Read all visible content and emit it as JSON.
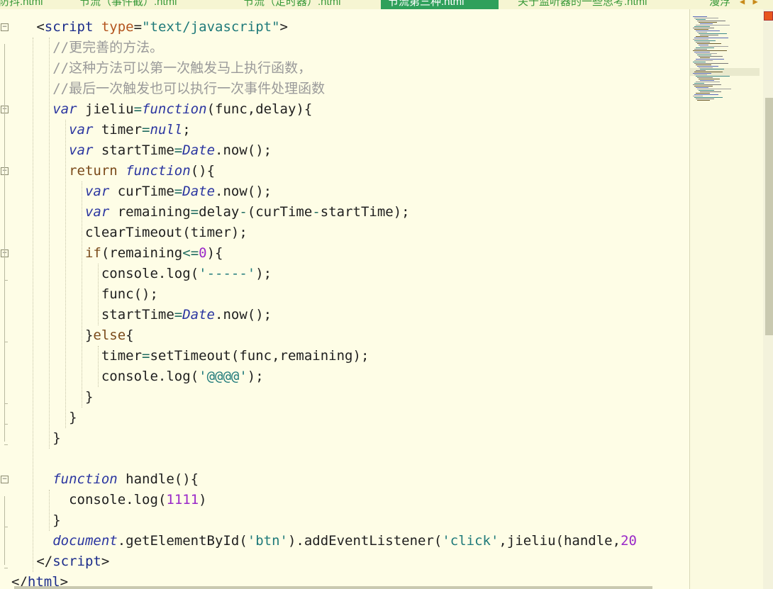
{
  "tabs": [
    {
      "label": "防抖.html",
      "active": false
    },
    {
      "label": "节流（事件截）.html",
      "active": false
    },
    {
      "label": "节流（定时器）.html",
      "active": false
    },
    {
      "label": "节流第三种.html",
      "active": true
    },
    {
      "label": "关于监听器的一些思考.html",
      "active": false
    },
    {
      "label": "漫浮",
      "active": false
    }
  ],
  "tab_arrows": "◀ ▶",
  "code_lines": [
    [
      [
        "t-punc",
        "<"
      ],
      [
        "t-tag",
        "script"
      ],
      [
        "t-punc",
        " "
      ],
      [
        "t-attr",
        "type"
      ],
      [
        "t-punc",
        "="
      ],
      [
        "t-str",
        "\"text/javascript\""
      ],
      [
        "t-punc",
        ">"
      ]
    ],
    [
      [
        "t-cmt",
        "//更完善的方法。"
      ]
    ],
    [
      [
        "t-cmt",
        "//这种方法可以第一次触发马上执行函数，"
      ]
    ],
    [
      [
        "t-cmt",
        "//最后一次触发也可以执行一次事件处理函数"
      ]
    ],
    [
      [
        "t-kw",
        "var"
      ],
      [
        "t-id",
        " jieliu"
      ],
      [
        "t-op",
        "="
      ],
      [
        "t-kw",
        "function"
      ],
      [
        "t-punc",
        "("
      ],
      [
        "t-id",
        "func"
      ],
      [
        "t-punc",
        ","
      ],
      [
        "t-id",
        "delay"
      ],
      [
        "t-punc",
        "){"
      ]
    ],
    [
      [
        "t-kw",
        "var"
      ],
      [
        "t-id",
        " timer"
      ],
      [
        "t-op",
        "="
      ],
      [
        "t-kw",
        "null"
      ],
      [
        "t-punc",
        ";"
      ]
    ],
    [
      [
        "t-kw",
        "var"
      ],
      [
        "t-id",
        " startTime"
      ],
      [
        "t-op",
        "="
      ],
      [
        "t-cls",
        "Date"
      ],
      [
        "t-punc",
        "."
      ],
      [
        "t-id",
        "now"
      ],
      [
        "t-punc",
        "();"
      ]
    ],
    [
      [
        "t-ret",
        "return"
      ],
      [
        "t-id",
        " "
      ],
      [
        "t-kw",
        "function"
      ],
      [
        "t-punc",
        "(){"
      ]
    ],
    [
      [
        "t-kw",
        "var"
      ],
      [
        "t-id",
        " curTime"
      ],
      [
        "t-op",
        "="
      ],
      [
        "t-cls",
        "Date"
      ],
      [
        "t-punc",
        "."
      ],
      [
        "t-id",
        "now"
      ],
      [
        "t-punc",
        "();"
      ]
    ],
    [
      [
        "t-kw",
        "var"
      ],
      [
        "t-id",
        " remaining"
      ],
      [
        "t-op",
        "="
      ],
      [
        "t-id",
        "delay"
      ],
      [
        "t-op",
        "-"
      ],
      [
        "t-punc",
        "("
      ],
      [
        "t-id",
        "curTime"
      ],
      [
        "t-op",
        "-"
      ],
      [
        "t-id",
        "startTime"
      ],
      [
        "t-punc",
        ");"
      ]
    ],
    [
      [
        "t-id",
        "clearTimeout"
      ],
      [
        "t-punc",
        "("
      ],
      [
        "t-id",
        "timer"
      ],
      [
        "t-punc",
        ");"
      ]
    ],
    [
      [
        "t-ret",
        "if"
      ],
      [
        "t-punc",
        "("
      ],
      [
        "t-id",
        "remaining"
      ],
      [
        "t-op",
        "<="
      ],
      [
        "t-num",
        "0"
      ],
      [
        "t-punc",
        "){"
      ]
    ],
    [
      [
        "t-id",
        "console"
      ],
      [
        "t-punc",
        "."
      ],
      [
        "t-id",
        "log"
      ],
      [
        "t-punc",
        "("
      ],
      [
        "t-str",
        "'-----'"
      ],
      [
        "t-punc",
        ");"
      ]
    ],
    [
      [
        "t-id",
        "func"
      ],
      [
        "t-punc",
        "();"
      ]
    ],
    [
      [
        "t-id",
        "startTime"
      ],
      [
        "t-op",
        "="
      ],
      [
        "t-cls",
        "Date"
      ],
      [
        "t-punc",
        "."
      ],
      [
        "t-id",
        "now"
      ],
      [
        "t-punc",
        "();"
      ]
    ],
    [
      [
        "t-punc",
        "}"
      ],
      [
        "t-ret",
        "else"
      ],
      [
        "t-punc",
        "{"
      ]
    ],
    [
      [
        "t-id",
        "timer"
      ],
      [
        "t-op",
        "="
      ],
      [
        "t-id",
        "setTimeout"
      ],
      [
        "t-punc",
        "("
      ],
      [
        "t-id",
        "func"
      ],
      [
        "t-punc",
        ","
      ],
      [
        "t-id",
        "remaining"
      ],
      [
        "t-punc",
        ");"
      ]
    ],
    [
      [
        "t-id",
        "console"
      ],
      [
        "t-punc",
        "."
      ],
      [
        "t-id",
        "log"
      ],
      [
        "t-punc",
        "("
      ],
      [
        "t-str",
        "'@@@@'"
      ],
      [
        "t-punc",
        ");"
      ]
    ],
    [
      [
        "t-punc",
        "}"
      ]
    ],
    [
      [
        "t-punc",
        "}"
      ]
    ],
    [
      [
        "t-punc",
        "}"
      ]
    ],
    [],
    [
      [
        "t-kw",
        "function"
      ],
      [
        "t-id",
        " handle"
      ],
      [
        "t-punc",
        "(){"
      ]
    ],
    [
      [
        "t-id",
        "console"
      ],
      [
        "t-punc",
        "."
      ],
      [
        "t-id",
        "log"
      ],
      [
        "t-punc",
        "("
      ],
      [
        "t-num",
        "1111"
      ],
      [
        "t-punc",
        ")"
      ]
    ],
    [
      [
        "t-punc",
        "}"
      ]
    ],
    [
      [
        "t-cls",
        "document"
      ],
      [
        "t-punc",
        "."
      ],
      [
        "t-id",
        "getElementById"
      ],
      [
        "t-punc",
        "("
      ],
      [
        "t-str",
        "'btn'"
      ],
      [
        "t-punc",
        ")."
      ],
      [
        "t-id",
        "addEventListener"
      ],
      [
        "t-punc",
        "("
      ],
      [
        "t-str",
        "'click'"
      ],
      [
        "t-punc",
        ","
      ],
      [
        "t-id",
        "jieliu"
      ],
      [
        "t-punc",
        "("
      ],
      [
        "t-id",
        "handle"
      ],
      [
        "t-punc",
        ","
      ],
      [
        "t-num",
        "20"
      ]
    ],
    [
      [
        "t-punc",
        "</"
      ],
      [
        "t-tag",
        "script"
      ],
      [
        "t-punc",
        ">"
      ]
    ],
    [
      [
        "t-punc",
        "</"
      ],
      [
        "t-tag",
        "html"
      ],
      [
        "t-punc",
        ">"
      ]
    ]
  ],
  "colors": {
    "editor_bg": "#fefde6",
    "active_tab": "#2fa05b",
    "keyword": "#2a35a0",
    "string": "#1f7a7a",
    "comment": "#9a9a9a",
    "number": "#9a28c8",
    "tag": "#1a2b8a",
    "attribute": "#b3541e"
  }
}
